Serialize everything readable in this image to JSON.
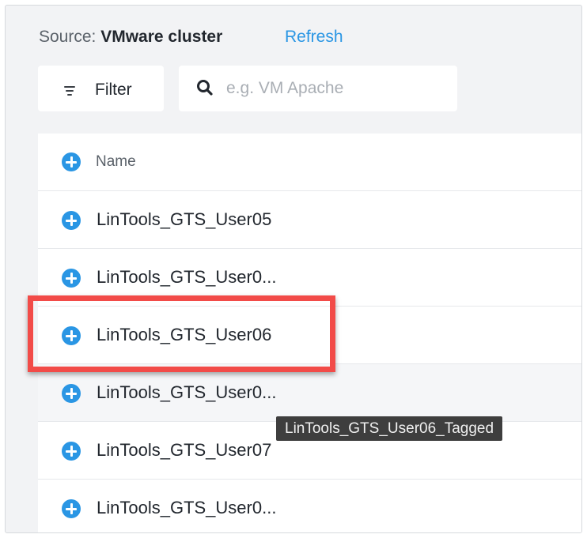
{
  "toolbar": {
    "source_prefix": "Source: ",
    "source_name": "VMware cluster",
    "refresh_label": "Refresh",
    "filter_label": "Filter",
    "search_placeholder": "e.g. VM Apache"
  },
  "table": {
    "column_name": "Name",
    "rows": [
      {
        "label": "LinTools_GTS_User05"
      },
      {
        "label": "LinTools_GTS_User0..."
      },
      {
        "label": "LinTools_GTS_User06"
      },
      {
        "label": "LinTools_GTS_User0..."
      },
      {
        "label": "LinTools_GTS_User07"
      },
      {
        "label": "LinTools_GTS_User0..."
      }
    ]
  },
  "tooltip": {
    "text": "LinTools_GTS_User06_Tagged"
  },
  "colors": {
    "accent": "#2a96e4",
    "highlight": "#f24b48"
  },
  "icons": {
    "filter": "filter-icon",
    "search": "search-icon",
    "add": "plus-circle-icon"
  }
}
